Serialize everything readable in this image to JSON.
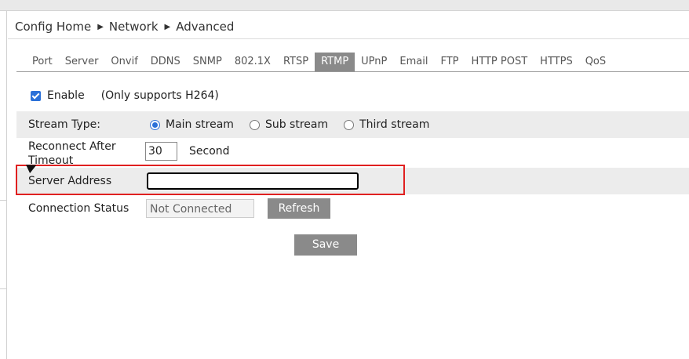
{
  "breadcrumb": [
    "Config Home",
    "Network",
    "Advanced"
  ],
  "tabs": [
    "Port",
    "Server",
    "Onvif",
    "DDNS",
    "SNMP",
    "802.1X",
    "RTSP",
    "RTMP",
    "UPnP",
    "Email",
    "FTP",
    "HTTP POST",
    "HTTPS",
    "QoS"
  ],
  "active_tab": "RTMP",
  "enable": {
    "label": "Enable",
    "checked": true,
    "note": "(Only supports H264)"
  },
  "stream_type": {
    "label": "Stream Type:",
    "options": [
      "Main stream",
      "Sub stream",
      "Third stream"
    ],
    "selected": "Main stream"
  },
  "reconnect": {
    "label": "Reconnect After Timeout",
    "value": "30",
    "unit": "Second"
  },
  "server_address": {
    "label": "Server Address",
    "value": ""
  },
  "connection_status": {
    "label": "Connection Status",
    "value": "Not Connected",
    "refresh_label": "Refresh"
  },
  "save_label": "Save",
  "colors": {
    "accent": "#2b71d8",
    "button": "#8a8a8a",
    "highlight": "#e02020",
    "row_alt": "#ececec"
  }
}
